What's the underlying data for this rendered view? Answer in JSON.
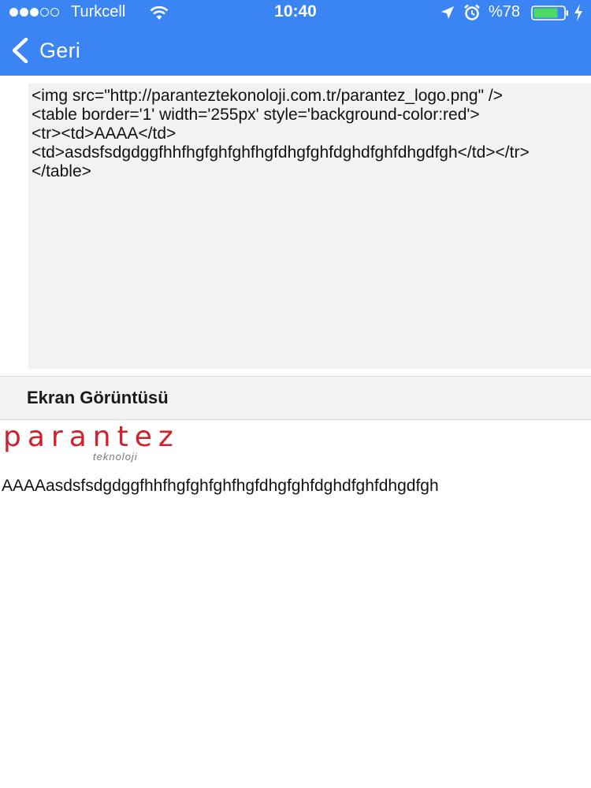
{
  "status_bar": {
    "carrier": "Turkcell",
    "time": "10:40",
    "battery": "%78",
    "signal_dots": [
      true,
      true,
      true,
      false,
      false
    ]
  },
  "nav": {
    "back_label": "Geri"
  },
  "code": {
    "text": "<img src=\"http://paranteztekonoloji.com.tr/parantez_logo.png\" />\n<table border='1' width='255px' style='background-color:red'>\n<tr><td>AAAA</td>\n<td>asdsfsdgdggfhhfhgfghfghfhgfdhgfghfdghdfghfdhgdfgh</td></tr>\n</table>"
  },
  "screenshot_section": {
    "title": "Ekran Görüntüsü"
  },
  "logo": {
    "text": "parantez",
    "subtext": "teknoloji"
  },
  "result": {
    "cell1": "AAAA",
    "cell2": "asdsfsdgdggfhhfhgfghfghfhgfdhgfghfdghdfghfdhgdfgh"
  },
  "colors": {
    "nav_bar": "#3a84f3",
    "logo_red": "#d0202a",
    "code_bg": "#f2f2f2"
  }
}
